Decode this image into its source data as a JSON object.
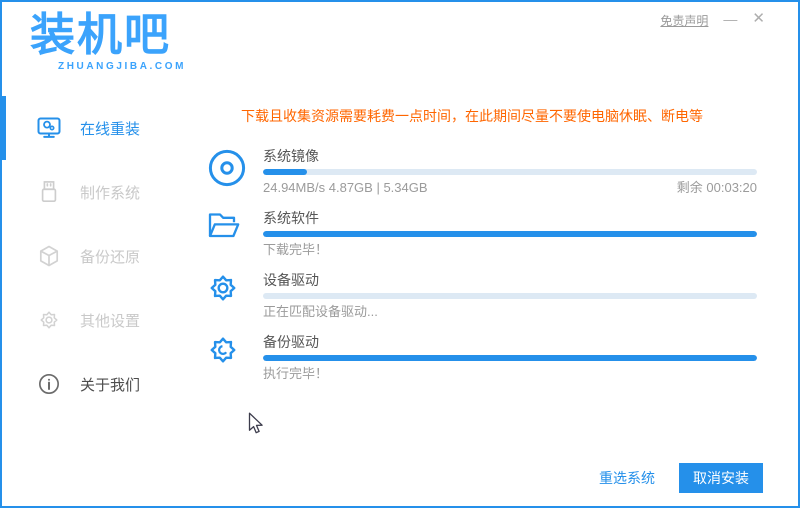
{
  "window": {
    "disclaimer": "免责声明",
    "minimize_glyph": "—",
    "close_glyph": "✕"
  },
  "logo": {
    "title": "装机吧",
    "subtitle": "ZHUANGJIBA.COM"
  },
  "sidebar": {
    "items": [
      {
        "label": "在线重装",
        "icon": "monitor-reinstall-icon",
        "active": true
      },
      {
        "label": "制作系统",
        "icon": "usb-icon",
        "active": false
      },
      {
        "label": "备份还原",
        "icon": "backup-restore-icon",
        "active": false
      },
      {
        "label": "其他设置",
        "icon": "settings-gear-icon",
        "active": false
      },
      {
        "label": "关于我们",
        "icon": "info-icon",
        "active": false
      }
    ]
  },
  "main": {
    "notice": "下载且收集资源需要耗费一点时间，在此期间尽量不要使电脑休眠、断电等",
    "tasks": [
      {
        "name": "系统镜像",
        "icon": "disc-icon",
        "progress_percent": 9,
        "status_left": "24.94MB/s 4.87GB | 5.34GB",
        "status_right": "剩余 00:03:20"
      },
      {
        "name": "系统软件",
        "icon": "folder-icon",
        "progress_percent": 100,
        "status_left": "下载完毕！",
        "status_right": ""
      },
      {
        "name": "设备驱动",
        "icon": "gear-icon",
        "progress_percent": 0,
        "status_left": "正在匹配设备驱动...",
        "status_right": ""
      },
      {
        "name": "备份驱动",
        "icon": "gear-sync-icon",
        "progress_percent": 100,
        "status_left": "执行完毕！",
        "status_right": ""
      }
    ]
  },
  "footer": {
    "reselect_label": "重选系统",
    "cancel_label": "取消安装"
  },
  "colors": {
    "primary_blue": "#2590ea",
    "logo_blue": "#3ba3fc",
    "notice_orange": "#ff6600",
    "track_blue": "#dde9f4",
    "inactive_gray": "#c9c9c9"
  }
}
